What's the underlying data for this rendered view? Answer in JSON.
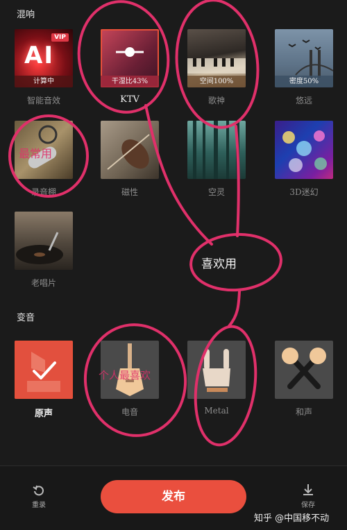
{
  "sections": {
    "reverb_title": "混响",
    "voice_title": "变音"
  },
  "reverb_effects": [
    {
      "label": "智能音效",
      "overlay": "计算中",
      "badge": "VIP"
    },
    {
      "label": "KTV",
      "overlay": "干湿比43%"
    },
    {
      "label": "歌神",
      "overlay": "空间100%"
    },
    {
      "label": "悠远",
      "overlay": "密度50%"
    },
    {
      "label": "录音棚"
    },
    {
      "label": "磁性"
    },
    {
      "label": "空灵"
    },
    {
      "label": "3D迷幻"
    },
    {
      "label": "老唱片"
    }
  ],
  "voice_effects": [
    {
      "label": "原声",
      "selected": true
    },
    {
      "label": "电音"
    },
    {
      "label": "Metal"
    },
    {
      "label": "和声"
    }
  ],
  "bottom": {
    "reset_label": "重录",
    "publish_label": "发布",
    "save_label": "保存"
  },
  "watermark": "知乎 @中国移不动",
  "handwriting": {
    "favorite": "喜欢用",
    "most_used": "最常用",
    "personal_pref": "个人最喜欢"
  },
  "colors": {
    "accent": "#ea4f3e",
    "annotation": "#e0306a"
  }
}
